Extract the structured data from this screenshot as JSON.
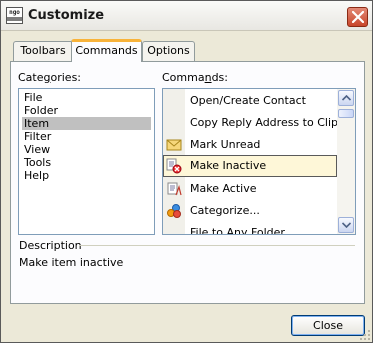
{
  "window": {
    "title": "Customize",
    "app_icon_text": "ngo"
  },
  "tabs": [
    {
      "label": "Toolbars",
      "active": false
    },
    {
      "label": "Commands",
      "active": true
    },
    {
      "label": "Options",
      "active": false
    }
  ],
  "categories": {
    "label_pre": "Cate",
    "label_u": "g",
    "label_post": "ories:",
    "items": [
      "File",
      "Folder",
      "Item",
      "Filter",
      "View",
      "Tools",
      "Help"
    ],
    "selected": "Item"
  },
  "commands": {
    "label_pre": "Comma",
    "label_u": "n",
    "label_post": "ds:",
    "items": [
      {
        "label": "Open/Create Contact",
        "icon": "none"
      },
      {
        "label": "Copy Reply Address to Clipboa",
        "icon": "none"
      },
      {
        "label": "Mark Unread",
        "icon": "envelope-icon"
      },
      {
        "label": "Make Inactive",
        "icon": "make-inactive-icon"
      },
      {
        "label": "Make Active",
        "icon": "make-active-icon"
      },
      {
        "label": "Categorize...",
        "icon": "categorize-icon"
      },
      {
        "label": "File to Any Folder",
        "icon": "none"
      }
    ],
    "selected": "Make Inactive"
  },
  "description": {
    "label": "Description",
    "text": "Make item inactive"
  },
  "buttons": {
    "close": "Close"
  }
}
